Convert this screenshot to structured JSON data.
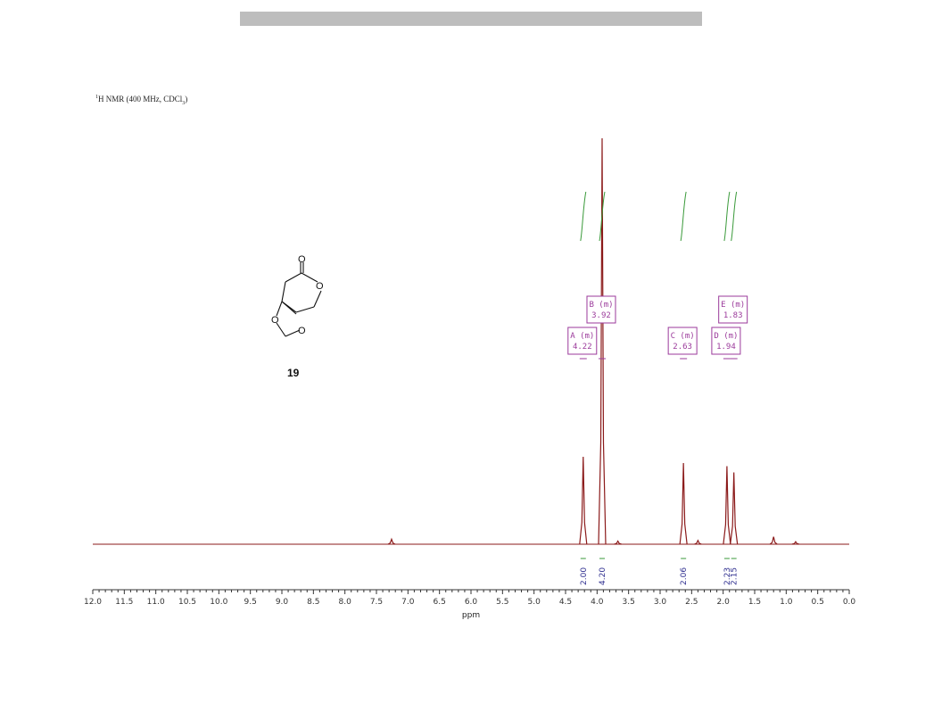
{
  "header": {
    "title": ""
  },
  "spectrum": {
    "title_prefix": "1",
    "title_main": "H NMR (400 MHz, CDCl",
    "title_sub": "3",
    "title_end": ")"
  },
  "compound": {
    "label": "19"
  },
  "colors": {
    "spectrum": "#8b1a1a",
    "integral": "#3a9a3a",
    "peak_label": "#9b3a9b",
    "integral_value": "#2e2e8f"
  },
  "chart_data": {
    "type": "line",
    "xlabel": "ppm",
    "xlim": [
      12.0,
      0.0
    ],
    "xticks": [
      "12.0",
      "11.5",
      "11.0",
      "10.5",
      "10.0",
      "9.5",
      "9.0",
      "8.5",
      "8.0",
      "7.5",
      "7.0",
      "6.5",
      "6.0",
      "5.5",
      "5.0",
      "4.5",
      "4.0",
      "3.5",
      "3.0",
      "2.5",
      "2.0",
      "1.5",
      "1.0",
      "0.5",
      "0.0"
    ],
    "peaks": [
      {
        "ppm": 7.26,
        "height": 0.08
      },
      {
        "ppm": 4.22,
        "height": 1.4
      },
      {
        "ppm": 3.92,
        "height": 6.5
      },
      {
        "ppm": 3.67,
        "height": 0.05
      },
      {
        "ppm": 2.63,
        "height": 1.3
      },
      {
        "ppm": 2.4,
        "height": 0.06
      },
      {
        "ppm": 1.94,
        "height": 1.25
      },
      {
        "ppm": 1.83,
        "height": 1.15
      },
      {
        "ppm": 1.2,
        "height": 0.12
      },
      {
        "ppm": 0.85,
        "height": 0.04
      }
    ],
    "multiplets": [
      {
        "label": "A (m)",
        "shift": "4.22",
        "ppm": 4.22
      },
      {
        "label": "B (m)",
        "shift": "3.92",
        "ppm": 3.92
      },
      {
        "label": "C (m)",
        "shift": "2.63",
        "ppm": 2.63
      },
      {
        "label": "D (m)",
        "shift": "1.94",
        "ppm": 1.94
      },
      {
        "label": "E (m)",
        "shift": "1.83",
        "ppm": 1.83
      }
    ],
    "integrals": [
      {
        "value": "2.00",
        "ppm": 4.22
      },
      {
        "value": "4.20",
        "ppm": 3.92
      },
      {
        "value": "2.06",
        "ppm": 2.63
      },
      {
        "value": "2.23",
        "ppm": 1.94
      },
      {
        "value": "2.15",
        "ppm": 1.83
      }
    ]
  }
}
